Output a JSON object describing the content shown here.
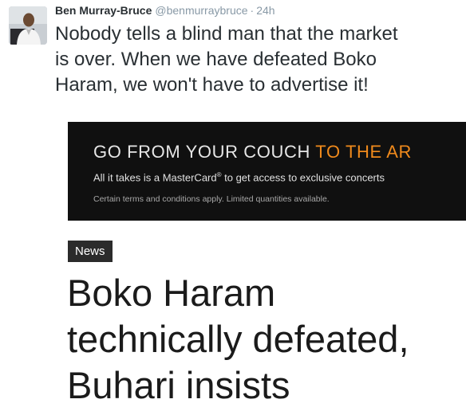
{
  "tweet": {
    "author": {
      "display_name": "Ben Murray-Bruce",
      "handle": "@benmurraybruce",
      "avatar_icon": "user-avatar"
    },
    "separator": "·",
    "time": "24h",
    "text": "Nobody tells a blind man that the market\nis over. When we have defeated Boko\nHaram, we won't have to advertise it!"
  },
  "media": {
    "ad": {
      "headline_main": "GO FROM YOUR COUCH",
      "headline_accent": "TO THE AR",
      "line_before": "All it takes is a MasterCard",
      "line_mark": "®",
      "line_after": " to get access to exclusive concerts",
      "fine_print": "Certain terms and conditions apply. Limited quantities available.",
      "accent_color": "#f08a1c"
    },
    "tag": "News",
    "headline": "Boko Haram\ntechnically defeated,\nBuhari insists"
  }
}
